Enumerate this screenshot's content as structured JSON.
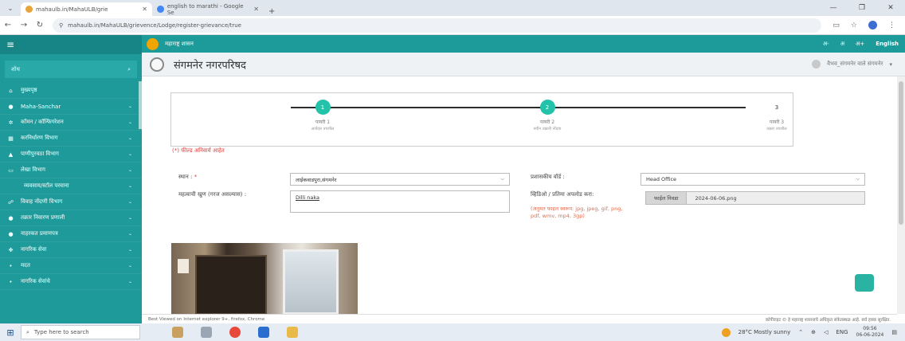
{
  "browser": {
    "tabs": [
      {
        "title": "mahaulb.in/MahaULB/grie",
        "active": true
      },
      {
        "title": "english to marathi - Google Se",
        "active": false
      }
    ],
    "url": "mahaulb.in/MahaULB/grievence/Lodge/register-grievance/true"
  },
  "topbar": {
    "title": "महाराष्ट्र शासन",
    "lang_small": "अ-",
    "lang_normal": "अ",
    "lang_big": "अ+",
    "lang_english": "English"
  },
  "org": {
    "name": "संगमनेर नगरपरिषद",
    "user": "वैभव_संगमनेर वाले संगमनेर"
  },
  "sidebar": {
    "search_label": "शोध",
    "items": [
      {
        "icon": "home-icon",
        "glyph": "⌂",
        "label": "मुख्यपृष्ठ",
        "chev": false
      },
      {
        "icon": "circle-icon",
        "glyph": "●",
        "label": "Maha-Sanchar",
        "chev": true
      },
      {
        "icon": "gear-icon",
        "glyph": "✲",
        "label": "कॉमन / कॉन्फिगरेशन",
        "chev": true
      },
      {
        "icon": "grid-icon",
        "glyph": "▦",
        "label": "करनिर्धारण विभाग",
        "chev": true
      },
      {
        "icon": "drop-icon",
        "glyph": "▲",
        "label": "पाणीपुरवठा विभाग",
        "chev": true
      },
      {
        "icon": "card-icon",
        "glyph": "▭",
        "label": "लेखा विभाग",
        "chev": true
      },
      {
        "icon": "dot-icon",
        "glyph": "",
        "label": "व्यवसाय/स्टॉल परवाना",
        "chev": true
      },
      {
        "icon": "ring-icon",
        "glyph": "☍",
        "label": "विवाह नोंदणी विभाग",
        "chev": true
      },
      {
        "icon": "circle-icon",
        "glyph": "●",
        "label": "तक्रार निवारण प्रणाली",
        "chev": true
      },
      {
        "icon": "circle-icon",
        "glyph": "●",
        "label": "नाहरकत प्रमाणपत्र",
        "chev": true
      },
      {
        "icon": "people-icon",
        "glyph": "✤",
        "label": "नागरिक सेवा",
        "chev": true
      },
      {
        "icon": "bullet-icon",
        "glyph": "•",
        "label": "मदत",
        "chev": true
      },
      {
        "icon": "bullet-icon",
        "glyph": "•",
        "label": "नागरिक सेवांचे",
        "chev": true
      }
    ]
  },
  "stepper": [
    {
      "num": "1",
      "title": "पायरी 1",
      "sub": "अर्जदार तपशील",
      "done": true
    },
    {
      "num": "2",
      "title": "पायरी 2",
      "sub": "नवीन तक्रारी नोंदवा",
      "done": true
    },
    {
      "num": "3",
      "title": "पायरी 3",
      "sub": "तक्रार तपशील",
      "done": false
    }
  ],
  "form": {
    "required_note": "(*) फील्ड अनिवार्य आहेत",
    "location_label": "स्थान :",
    "location_star": "*",
    "location_value": "लाईकवाडपुरा,संगमनेर",
    "ward_label": "प्रशासकीय वॉर्ड :",
    "ward_value": "Head Office",
    "landmark_label": "महत्वाची खुण (गरज असल्यास) :",
    "landmark_value": "Dilli naka",
    "upload_label": "व्हिडिओ / प्रतिमा अपलोड करा:",
    "upload_hint": "(अनुमत फाइल स्वरूप: jpg, jpeg, gif, png, pdf, wmv, mp4, 3gp)",
    "choose_file": "फाईल निवडा",
    "file_name": "2024-06-06.png"
  },
  "footer": {
    "left": "Best Viewed on Internet explorer 9+, firefox, Chrome",
    "right": "कॉपीराइट © हे महाराष्ट्र शासनाचे अधिकृत संकेतस्थळ आहे. सर्व हक्क सुरक्षित."
  },
  "taskbar": {
    "search_placeholder": "Type here to search",
    "weather": "28°C  Mostly sunny",
    "lang": "ENG",
    "time": "09:56",
    "date": "06-06-2024"
  }
}
